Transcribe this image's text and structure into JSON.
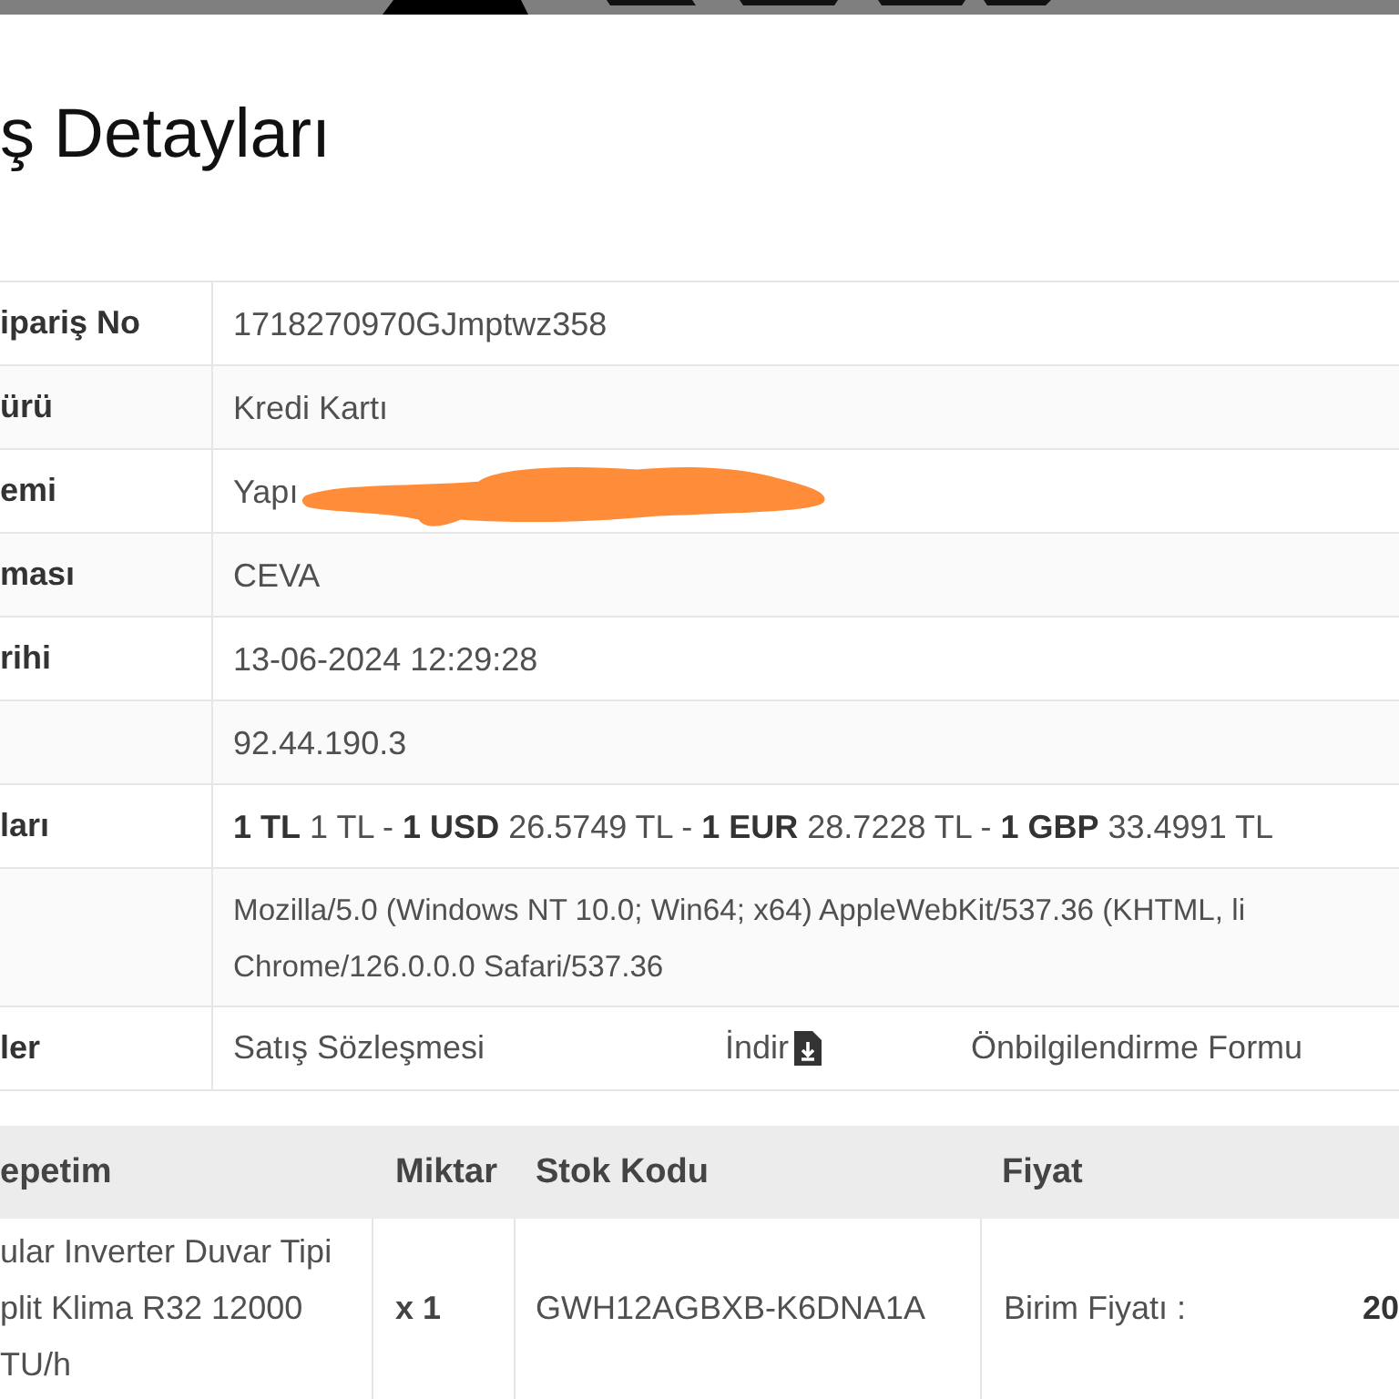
{
  "page_title": "ş Detayları",
  "details": [
    {
      "label": "ipariş No",
      "kind": "text",
      "value": "1718270970GJmptwz358",
      "redacted": false
    },
    {
      "label": "ürü",
      "kind": "text",
      "value": "Kredi Kartı",
      "redacted": false
    },
    {
      "label": "emi",
      "kind": "text",
      "value": "Yapı",
      "redacted": true
    },
    {
      "label": "ması",
      "kind": "text",
      "value": "CEVA",
      "redacted": false
    },
    {
      "label": "rihi",
      "kind": "text",
      "value": "13-06-2024 12:29:28",
      "redacted": false
    },
    {
      "kind": "text",
      "value": "92.44.190.3",
      "redacted": false
    },
    {
      "label": "ları",
      "kind": "rich",
      "value": "**1 TL** 1 TL - **1 USD** 26.5749 TL - **1 EUR** 28.7228 TL - **1 GBP** 33.4991 TL",
      "redacted": false
    },
    {
      "kind": "lines",
      "lines": [
        "Mozilla/5.0 (Windows NT 10.0; Win64; x64) AppleWebKit/537.36 (KHTML, li",
        "Chrome/126.0.0.0 Safari/537.36"
      ],
      "redacted": false
    },
    {
      "label": "ler",
      "kind": "documents",
      "documents": [
        {
          "title": "Satış Sözleşmesi",
          "action": "İndir"
        },
        {
          "title": "Önbilgilendirme Formu"
        }
      ],
      "redacted": false
    }
  ],
  "cart": {
    "columns": [
      "epetim",
      "Miktar",
      "Stok Kodu",
      "Fiyat"
    ],
    "rows": [
      {
        "product_lines": [
          "ular Inverter Duvar Tipi",
          "plit Klima R32 12000",
          "TU/h"
        ],
        "quantity": "x 1",
        "stock_code": "GWH12AGBXB-K6DNA1A",
        "price_label": "Birim Fiyatı :",
        "price_value": "20"
      }
    ]
  }
}
